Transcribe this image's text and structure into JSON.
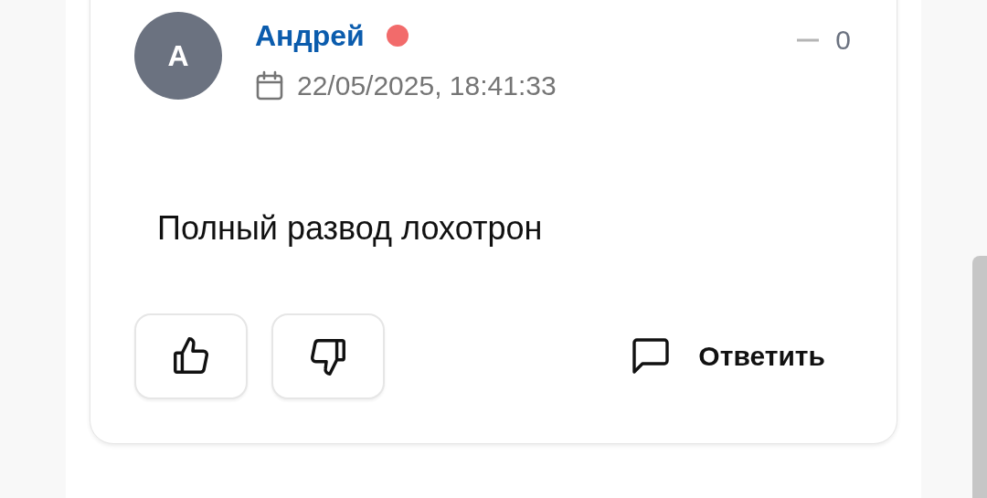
{
  "comment": {
    "author": "Андрей",
    "avatar_letter": "А",
    "online": false,
    "date": "22/05/2025, 18:41:33",
    "score": "0",
    "text": "Полный развод лохотрон",
    "reply_label": "Ответить"
  }
}
